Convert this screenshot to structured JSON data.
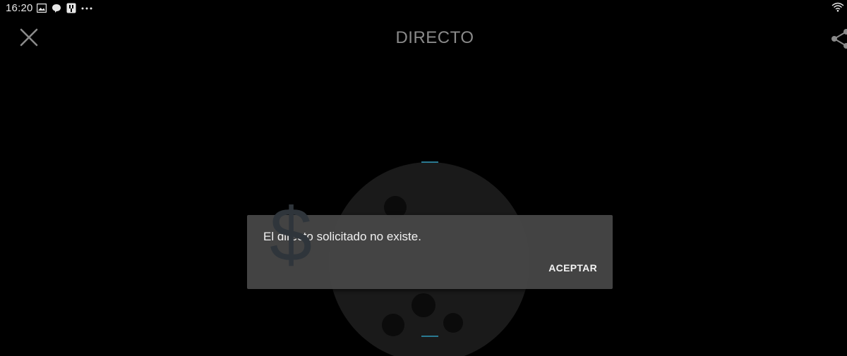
{
  "status_bar": {
    "time": "16:20",
    "icons": [
      "image-icon",
      "chat-bubble-icon",
      "app-notification-icon",
      "more-dots-icon",
      "wifi-icon"
    ]
  },
  "app_bar": {
    "title": "DIRECTO",
    "close_icon": "close-icon",
    "share_icon": "share-icon"
  },
  "dialog": {
    "message": "El directo solicitado no existe.",
    "accept_label": "ACEPTAR",
    "overlay_glyph": "$"
  },
  "colors": {
    "background": "#000000",
    "dialog": "#484848",
    "accent": "#2a7a92",
    "title": "#8a8a8a"
  }
}
